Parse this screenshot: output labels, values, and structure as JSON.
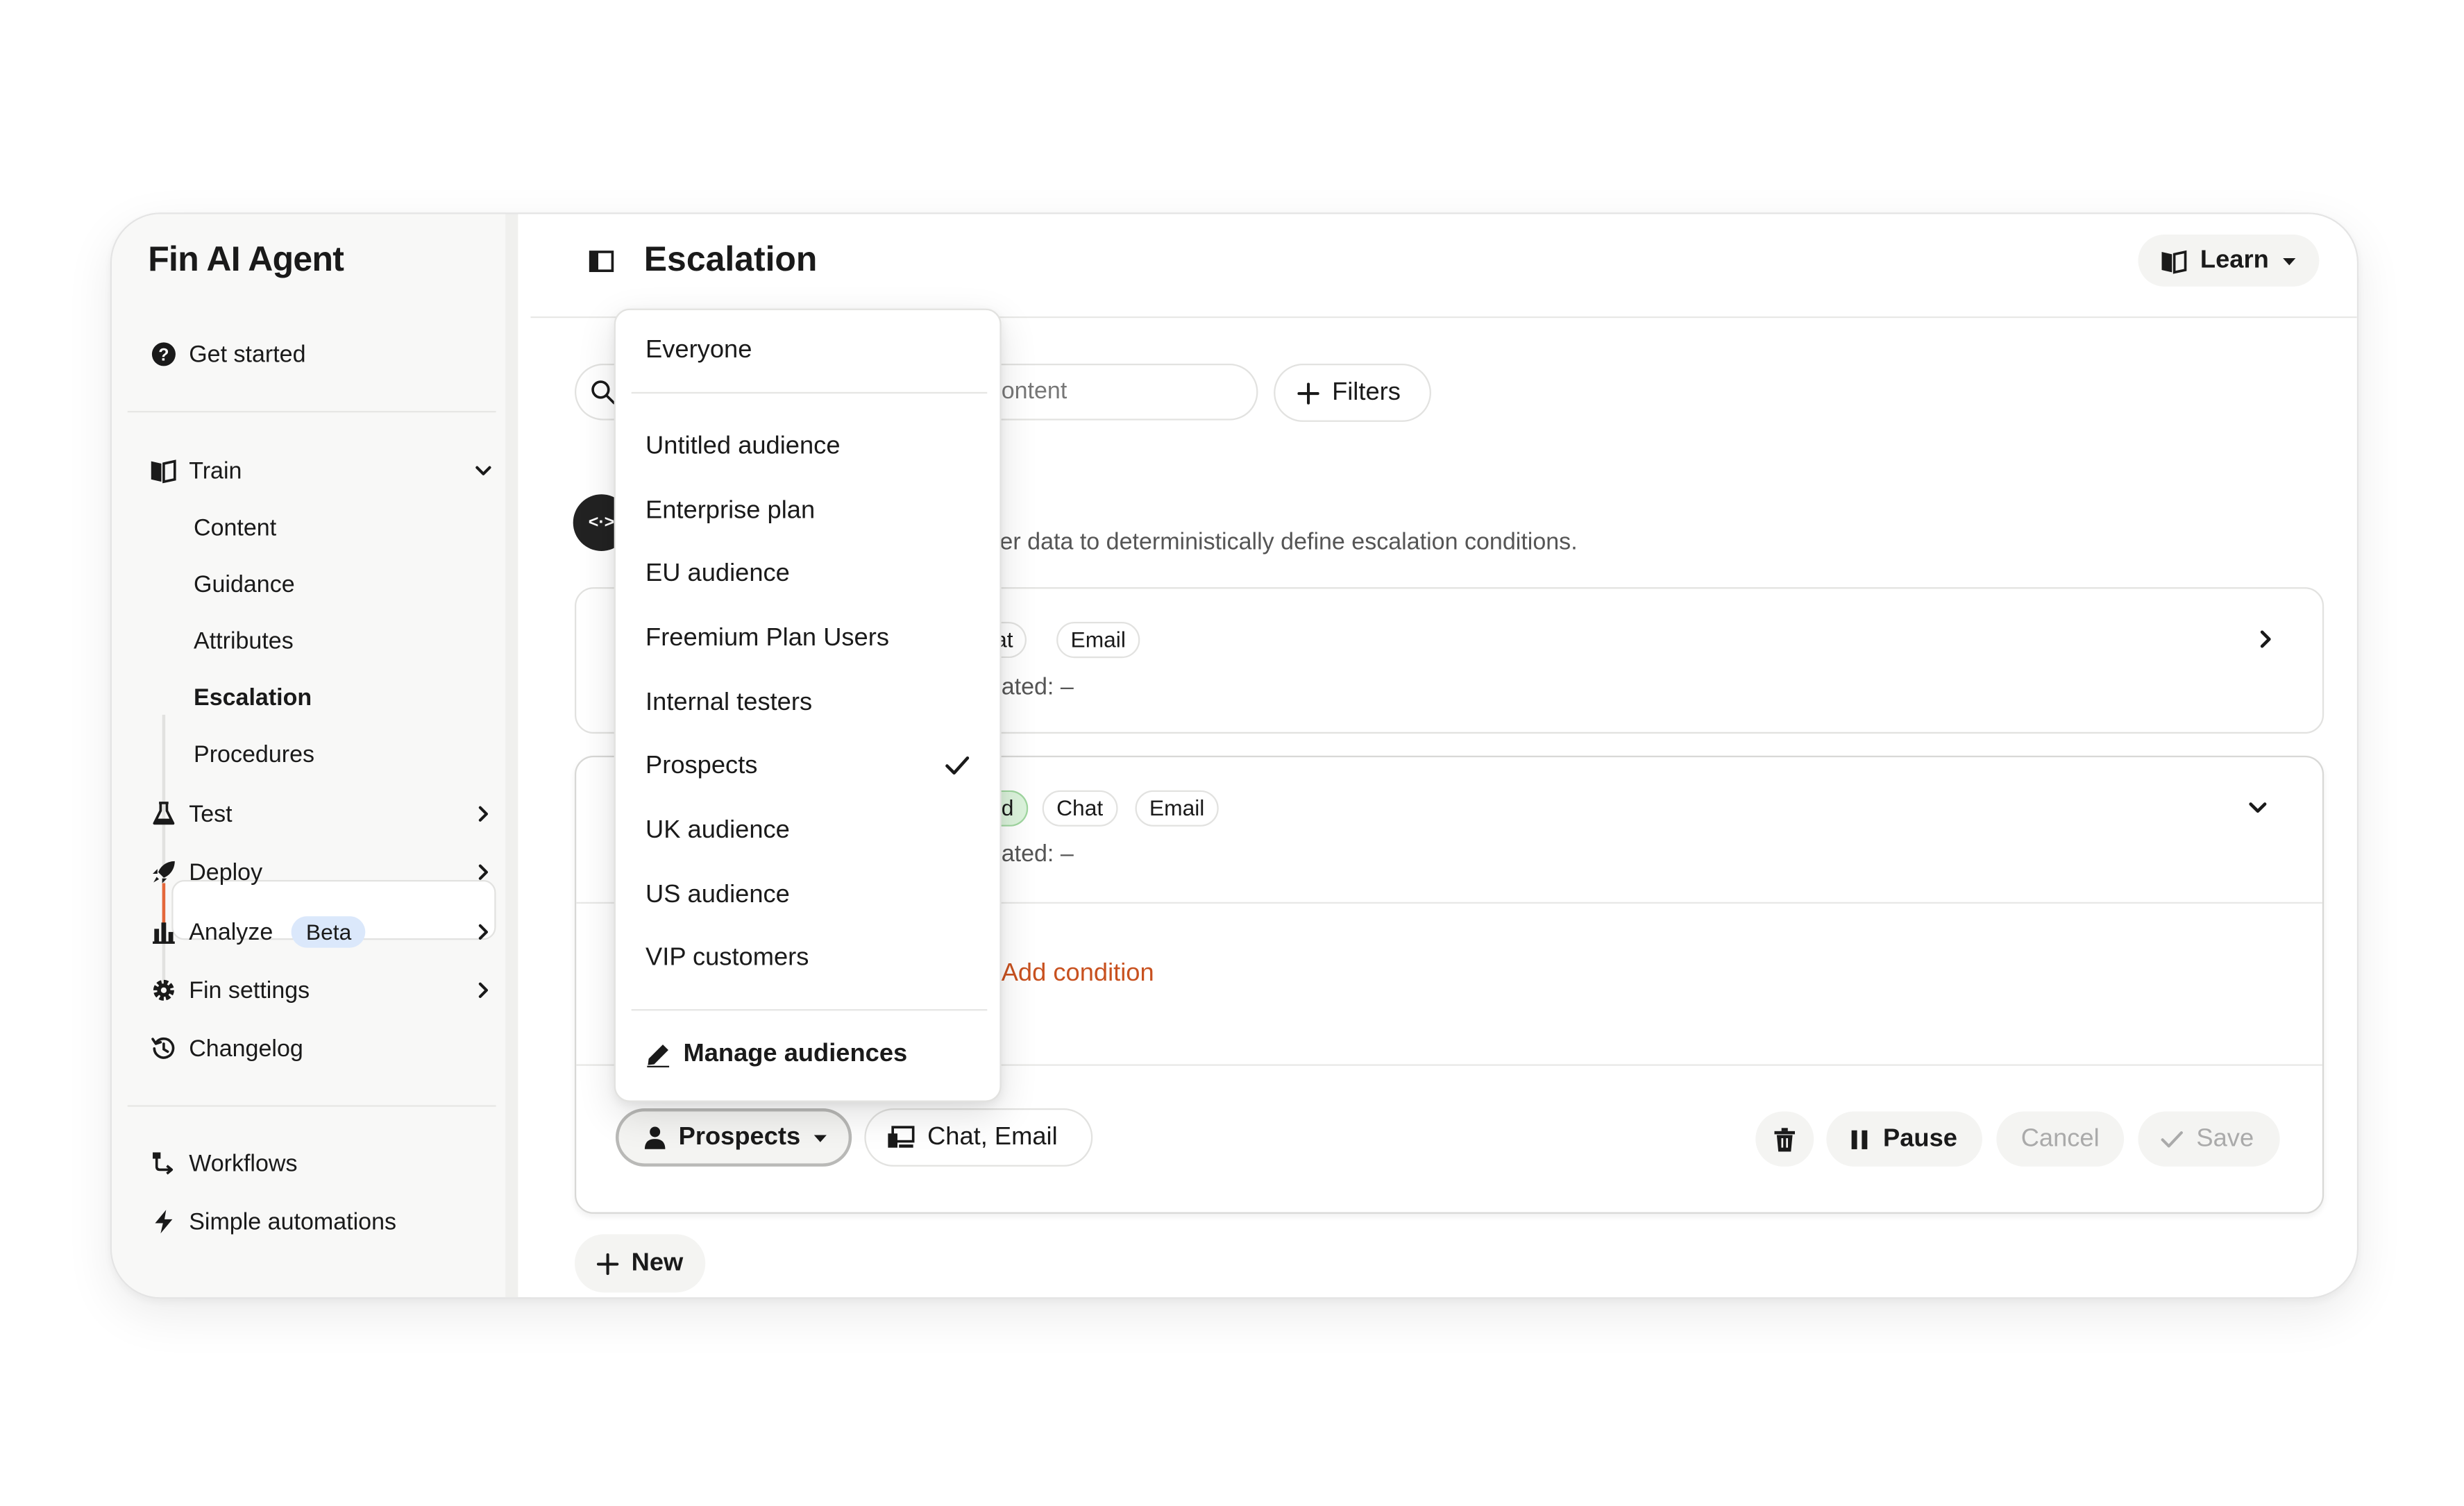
{
  "sidebar": {
    "app_title": "Fin AI Agent",
    "get_started": "Get started",
    "train": {
      "label": "Train",
      "children": [
        "Content",
        "Guidance",
        "Attributes",
        "Escalation",
        "Procedures"
      ],
      "active": "Escalation"
    },
    "test": "Test",
    "deploy": "Deploy",
    "analyze": "Analyze",
    "analyze_badge": "Beta",
    "fin_settings": "Fin settings",
    "changelog": "Changelog",
    "workflows": "Workflows",
    "simple_automations": "Simple automations"
  },
  "header": {
    "title": "Escalation",
    "learn_label": "Learn"
  },
  "search": {
    "placeholder_visible": "ontent"
  },
  "filters_label": "Filters",
  "intro": {
    "icon_text": "<·>",
    "description_visible": "er data to deterministically define escalation conditions."
  },
  "rule_cards": [
    {
      "channel_tags": [
        "hat",
        "Email"
      ],
      "meta_visible": "ated: –"
    },
    {
      "status_tag_visible": "d",
      "channel_tags": [
        "Chat",
        "Email"
      ],
      "meta_visible": "ated: –",
      "add_condition_visible": "Add condition",
      "audience_button": "Prospects",
      "channels_button": "Chat, Email",
      "pause_label": "Pause",
      "cancel_label": "Cancel",
      "save_label": "Save"
    }
  ],
  "new_label": "New",
  "audience_dropdown": {
    "everyone": "Everyone",
    "options": [
      "Untitled audience",
      "Enterprise plan",
      "EU audience",
      "Freemium Plan Users",
      "Internal testers",
      "Prospects",
      "UK audience",
      "US audience",
      "VIP customers"
    ],
    "selected": "Prospects",
    "manage_label": "Manage audiences"
  },
  "colors": {
    "accent_orange": "#c8511f",
    "active_bar": "#e4673a",
    "beta_badge": "#dbe8fb",
    "live_tag_green": "#dcf3dc"
  }
}
